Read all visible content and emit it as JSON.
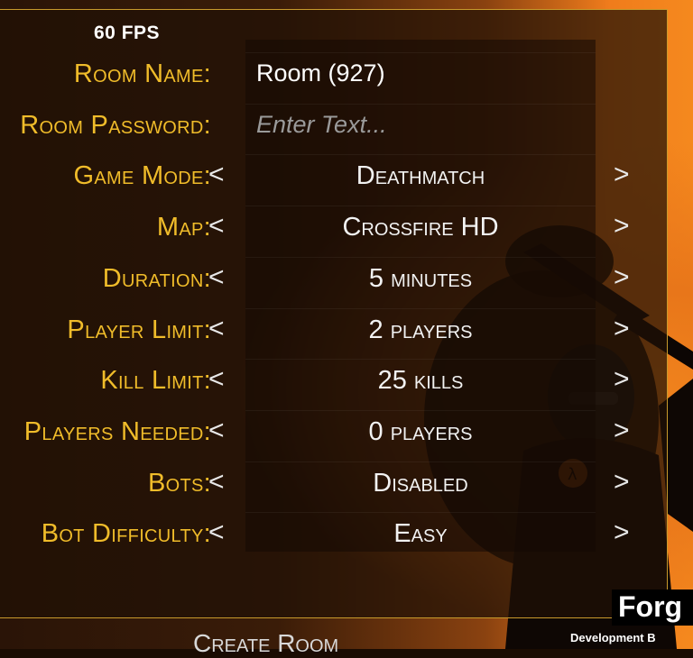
{
  "fps": "60 FPS",
  "fields": [
    {
      "label": "Room Name:",
      "value": "Room (927)",
      "kind": "text"
    },
    {
      "label": "Room Password:",
      "value": "",
      "placeholder": "Enter Text...",
      "kind": "text"
    },
    {
      "label": "Game Mode:",
      "value": "Deathmatch",
      "kind": "select"
    },
    {
      "label": "Map:",
      "value": "Crossfire HD",
      "kind": "select"
    },
    {
      "label": "Duration:",
      "value": "5 minutes",
      "kind": "select"
    },
    {
      "label": "Player Limit:",
      "value": "2 players",
      "kind": "select"
    },
    {
      "label": "Kill Limit:",
      "value": "25 kills",
      "kind": "select"
    },
    {
      "label": "Players Needed:",
      "value": "0 players",
      "kind": "select"
    },
    {
      "label": "Bots:",
      "value": "Disabled",
      "kind": "select"
    },
    {
      "label": "Bot Difficulty:",
      "value": "Easy",
      "kind": "select"
    }
  ],
  "arrows": {
    "left": "<",
    "right": ">"
  },
  "create_button": "Create Room",
  "logo": {
    "title": "Forg",
    "subtitle": "Development B"
  },
  "colors": {
    "label": "#f0bc2a",
    "value": "#f2f2f2",
    "background_accent": "#f07c1c",
    "border": "#c89a2c"
  }
}
